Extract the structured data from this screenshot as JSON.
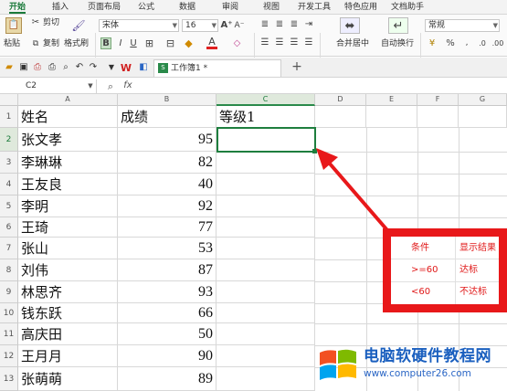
{
  "menu": {
    "items": [
      "开始",
      "插入",
      "页面布局",
      "公式",
      "数据",
      "审阅",
      "视图",
      "开发工具",
      "特色应用",
      "文档助手"
    ]
  },
  "ribbon": {
    "paste_label": "粘贴",
    "cut_label": "剪切",
    "copy_label": "复制",
    "format_painter_label": "格式刷",
    "font_name": "宋体",
    "font_size": "16",
    "merge_label": "合并居中",
    "wrap_label": "自动换行",
    "number_format": "常规",
    "bold": "B",
    "italic": "I",
    "underline": "U",
    "font_color_letter": "A"
  },
  "quick_access": {
    "file_tab": "工作簿1 *",
    "new_tab": "+"
  },
  "formula_bar": {
    "cell_ref": "C2",
    "fx": "fx",
    "content": ""
  },
  "grid": {
    "columns": [
      "A",
      "B",
      "C",
      "D",
      "E",
      "F",
      "G"
    ],
    "selected_column": "C",
    "row_numbers": [
      "1",
      "2",
      "3",
      "4",
      "5",
      "6",
      "7",
      "8",
      "9",
      "10",
      "11",
      "12",
      "13"
    ],
    "selected_row": "2",
    "headers": {
      "A": "姓名",
      "B": "成绩",
      "C": "等级1"
    },
    "rows": [
      {
        "name": "张文孝",
        "score": "95"
      },
      {
        "name": "李琳琳",
        "score": "82"
      },
      {
        "name": "王友良",
        "score": "40"
      },
      {
        "name": "李明",
        "score": "92"
      },
      {
        "name": "王琦",
        "score": "77"
      },
      {
        "name": "张山",
        "score": "53"
      },
      {
        "name": "刘伟",
        "score": "87"
      },
      {
        "name": "林思齐",
        "score": "93"
      },
      {
        "name": "钱东跃",
        "score": "66"
      },
      {
        "name": "高庆田",
        "score": "50"
      },
      {
        "name": "王月月",
        "score": "90"
      },
      {
        "name": "张萌萌",
        "score": "89"
      }
    ]
  },
  "annotation": {
    "header": [
      "条件",
      "显示结果"
    ],
    "rows": [
      [
        ">=60",
        "达标"
      ],
      [
        "<60",
        "不达标"
      ]
    ],
    "color": "#e8181a"
  },
  "watermark": {
    "title": "电脑软硬件教程网",
    "url": "www.computer26.com"
  },
  "colors": {
    "accent": "#1a7a3a",
    "annotation_red": "#e8181a",
    "logo_blue": "#1a5fbf"
  }
}
